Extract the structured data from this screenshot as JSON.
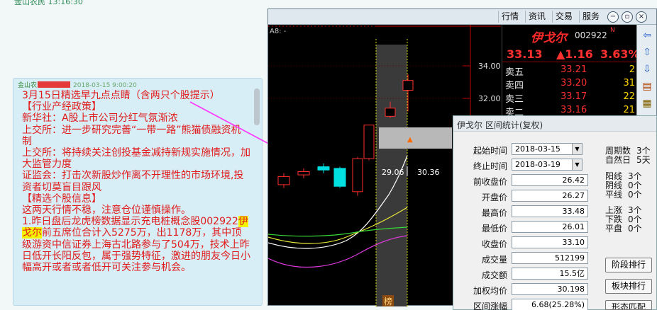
{
  "top_partial_text": "金山农民  13:16:30",
  "chat": {
    "sender": "金山农",
    "timestamp": "2018-03-15 9:00:20",
    "lines": [
      "3月15日精选早九点点睛（含两只个股提示）",
      "【行业产经政策】",
      "新华社：A股上市公司分红气氛渐浓",
      "上交所：进一步研究完善“一带一路”熊猫债融资机制",
      "上交所：将持续关注创投基金减持新规实施情况，加大监管力度",
      "证监会：打击次新股炒作离不开理性的市场环境,投资者切莫盲目跟风",
      "【精选个股信息】",
      "这两天行情不稳，注意仓位谨慎操作。"
    ],
    "line9_pre": "1.昨日盘后龙虎榜数据显示充电桩概念股002922",
    "line9_hl": "伊戈尔",
    "line9_post": "前五席位合计入5275万，出1178万，其中顶级游资中信证券上海古北路参与了504万，技术上昨日低开长阳反包，属于强势特征，激进的朋友今日小幅高开或者或者低开可关注参与机会。"
  },
  "window": {
    "menu": [
      "行情",
      "资讯",
      "交易",
      "服务"
    ],
    "controls": [
      "minimize",
      "restore",
      "close"
    ]
  },
  "chart": {
    "top_label": "A8: -",
    "axis_prices": [
      "34.00",
      "32.00"
    ],
    "tooltip_left": "29.06",
    "tooltip_right": "30.36",
    "bottom_mark": "榜"
  },
  "chart_data": {
    "type": "candlestick",
    "y_labels": [
      34.0,
      32.0
    ],
    "candles": [
      {
        "open": 26.7,
        "close": 27.2,
        "high": 27.4,
        "low": 26.5,
        "color": "red"
      },
      {
        "open": 27.3,
        "close": 27.5,
        "high": 27.7,
        "low": 27.1,
        "color": "red"
      },
      {
        "open": 27.6,
        "close": 27.8,
        "high": 28.0,
        "low": 27.4,
        "color": "cyan"
      },
      {
        "open": 27.7,
        "close": 26.6,
        "high": 27.8,
        "low": 26.5,
        "color": "cyan"
      },
      {
        "open": 26.27,
        "close": 28.3,
        "high": 28.4,
        "low": 26.01,
        "color": "red"
      },
      {
        "open": 28.3,
        "close": 30.36,
        "high": 30.36,
        "low": 28.2,
        "color": "red"
      },
      {
        "open": 30.9,
        "close": 31.4,
        "high": 31.8,
        "low": 30.8,
        "color": "red"
      },
      {
        "open": 32.5,
        "close": 33.1,
        "high": 33.48,
        "low": 31.2,
        "color": "red"
      }
    ]
  },
  "quote": {
    "name": "伊戈尔",
    "code": "002922",
    "flag": "N",
    "price": "33.13",
    "change": "▲1.16",
    "pct": "3.63%",
    "asks": [
      {
        "label": "卖五",
        "price": "33.21",
        "vol": "2"
      },
      {
        "label": "卖四",
        "price": "33.20",
        "vol": "31"
      },
      {
        "label": "卖三",
        "price": "33.17",
        "vol": "22"
      },
      {
        "label": "卖二",
        "price": "33.16",
        "vol": "21"
      }
    ]
  },
  "side_icons": [
    "arrow-left-icon",
    "arrow-up-icon",
    "arrow-down-icon",
    "report-icon",
    "grid-icon",
    "chart-icon"
  ],
  "dialog": {
    "title": "伊戈尔 区间统计(复权)",
    "start_label": "起始时间",
    "start_value": "2018-03-15",
    "end_label": "终止时间",
    "end_value": "2018-03-19",
    "rows": [
      {
        "label": "前收盘价",
        "value": "26.42"
      },
      {
        "label": "开盘价",
        "value": "26.27"
      },
      {
        "label": "最高价",
        "value": "33.48"
      },
      {
        "label": "最低价",
        "value": "26.01"
      },
      {
        "label": "收盘价",
        "value": "33.10"
      },
      {
        "label": "成交量",
        "value": "512199"
      },
      {
        "label": "成交额",
        "value": "15.5亿"
      },
      {
        "label": "加权均价",
        "value": "30.198"
      },
      {
        "label": "区间涨幅",
        "value": "6.68(25.28%)"
      }
    ],
    "period": {
      "label1": "周期数",
      "val1": "3个",
      "label2": "自然日",
      "val2": "5天"
    },
    "yinyang": [
      {
        "label": "阳线",
        "val": "3个"
      },
      {
        "label": "阴线",
        "val": "0个"
      },
      {
        "label": "平线",
        "val": "0个"
      }
    ],
    "updown": [
      {
        "label": "上涨",
        "val": "3个"
      },
      {
        "label": "下跌",
        "val": "0个"
      },
      {
        "label": "平盘",
        "val": "0个"
      }
    ],
    "buttons": [
      "阶段排行",
      "板块排行",
      "形态匹配"
    ]
  }
}
